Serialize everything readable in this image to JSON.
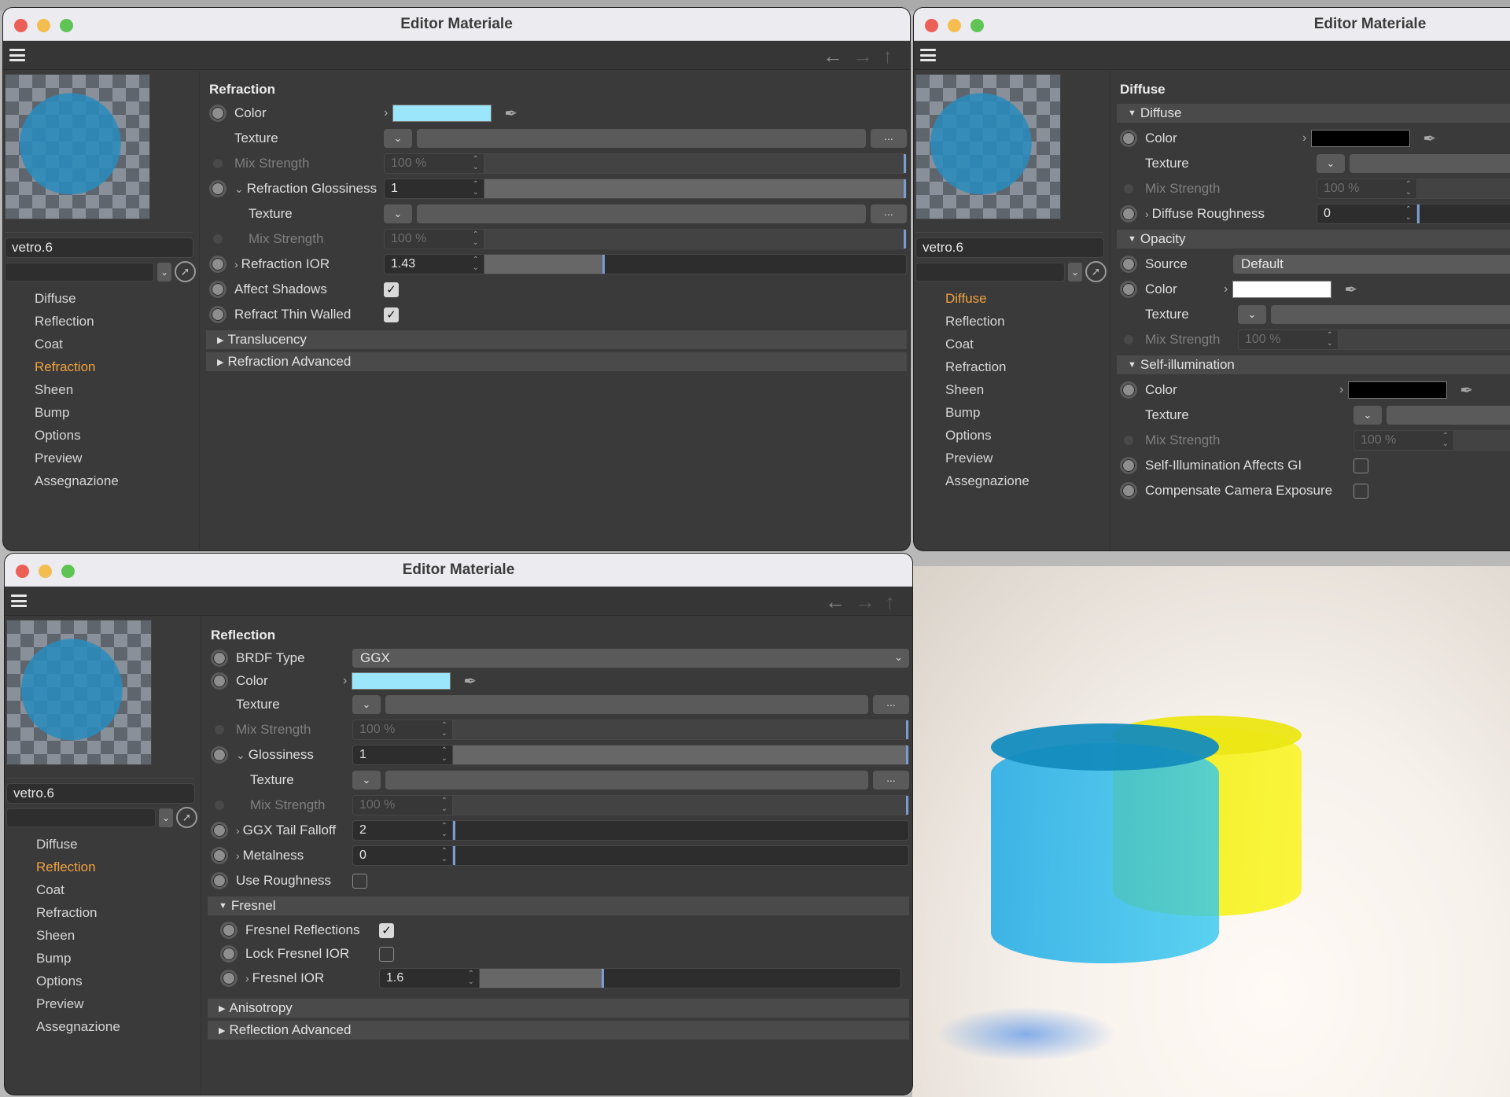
{
  "windows": {
    "refraction": {
      "title": "Editor Materiale",
      "material_name": "vetro.6",
      "nav": [
        "Diffuse",
        "Reflection",
        "Coat",
        "Refraction",
        "Sheen",
        "Bump",
        "Options",
        "Preview",
        "Assegnazione"
      ],
      "active_nav": "Refraction",
      "section": "Refraction",
      "rows": {
        "color": {
          "label": "Color",
          "swatch": "#9be6fb"
        },
        "texture1": {
          "label": "Texture",
          "more": "..."
        },
        "mix1": {
          "label": "Mix Strength",
          "value": "100 %",
          "fraction": 1.0
        },
        "gloss": {
          "label": "Refraction Glossiness",
          "value": "1",
          "fraction": 1.0
        },
        "texture2": {
          "label": "Texture",
          "more": "..."
        },
        "mix2": {
          "label": "Mix Strength",
          "value": "100 %",
          "fraction": 1.0
        },
        "ior": {
          "label": "Refraction IOR",
          "value": "1.43",
          "fraction": 0.28
        },
        "affect_shadows": {
          "label": "Affect Shadows",
          "checked": true
        },
        "thin_walled": {
          "label": "Refract Thin Walled",
          "checked": true
        }
      },
      "groups": [
        "Translucency",
        "Refraction Advanced"
      ]
    },
    "diffuse": {
      "title": "Editor Materiale",
      "material_name": "vetro.6",
      "nav": [
        "Diffuse",
        "Reflection",
        "Coat",
        "Refraction",
        "Sheen",
        "Bump",
        "Options",
        "Preview",
        "Assegnazione"
      ],
      "active_nav": "Diffuse",
      "section": "Diffuse",
      "diffuse_group": "Diffuse",
      "diffuse": {
        "color": {
          "label": "Color",
          "swatch": "#000000"
        },
        "texture": {
          "label": "Texture"
        },
        "mix": {
          "label": "Mix Strength",
          "value": "100 %"
        },
        "roughness": {
          "label": "Diffuse Roughness",
          "value": "0",
          "fraction": 0.0
        }
      },
      "opacity_group": "Opacity",
      "opacity": {
        "source": {
          "label": "Source",
          "value": "Default"
        },
        "color": {
          "label": "Color",
          "swatch": "#ffffff"
        },
        "texture": {
          "label": "Texture"
        },
        "mix": {
          "label": "Mix Strength",
          "value": "100 %"
        }
      },
      "selfillum_group": "Self-illumination",
      "selfillum": {
        "color": {
          "label": "Color",
          "swatch": "#000000"
        },
        "texture": {
          "label": "Texture"
        },
        "mix": {
          "label": "Mix Strength",
          "value": "100 %"
        },
        "affects_gi": {
          "label": "Self-Illumination Affects GI",
          "checked": false
        },
        "compensate": {
          "label": "Compensate Camera Exposure",
          "checked": false
        }
      }
    },
    "reflection": {
      "title": "Editor Materiale",
      "material_name": "vetro.6",
      "nav": [
        "Diffuse",
        "Reflection",
        "Coat",
        "Refraction",
        "Sheen",
        "Bump",
        "Options",
        "Preview",
        "Assegnazione"
      ],
      "active_nav": "Reflection",
      "section": "Reflection",
      "rows": {
        "brdf": {
          "label": "BRDF Type",
          "value": "GGX"
        },
        "color": {
          "label": "Color",
          "swatch": "#9be6fb"
        },
        "texture1": {
          "label": "Texture",
          "more": "..."
        },
        "mix1": {
          "label": "Mix Strength",
          "value": "100 %",
          "fraction": 1.0
        },
        "gloss": {
          "label": "Glossiness",
          "value": "1",
          "fraction": 1.0
        },
        "texture2": {
          "label": "Texture",
          "more": "..."
        },
        "mix2": {
          "label": "Mix Strength",
          "value": "100 %",
          "fraction": 1.0
        },
        "tail": {
          "label": "GGX Tail Falloff",
          "value": "2",
          "fraction": 0.0
        },
        "metal": {
          "label": "Metalness",
          "value": "0",
          "fraction": 0.0
        },
        "use_rough": {
          "label": "Use Roughness",
          "checked": false
        }
      },
      "fresnel_group": "Fresnel",
      "fresnel": {
        "reflections": {
          "label": "Fresnel Reflections",
          "checked": true
        },
        "lock_ior": {
          "label": "Lock Fresnel IOR",
          "checked": false
        },
        "ior": {
          "label": "Fresnel IOR",
          "value": "1.6",
          "fraction": 0.29
        }
      },
      "groups": [
        "Anisotropy",
        "Reflection Advanced"
      ]
    }
  },
  "icons": {
    "checkmark": "✓",
    "dropdown": "⌄",
    "more": "...",
    "eyedropper": "✒",
    "spin": "⌃⌄",
    "back": "←",
    "forward": "→",
    "up": "↑"
  }
}
